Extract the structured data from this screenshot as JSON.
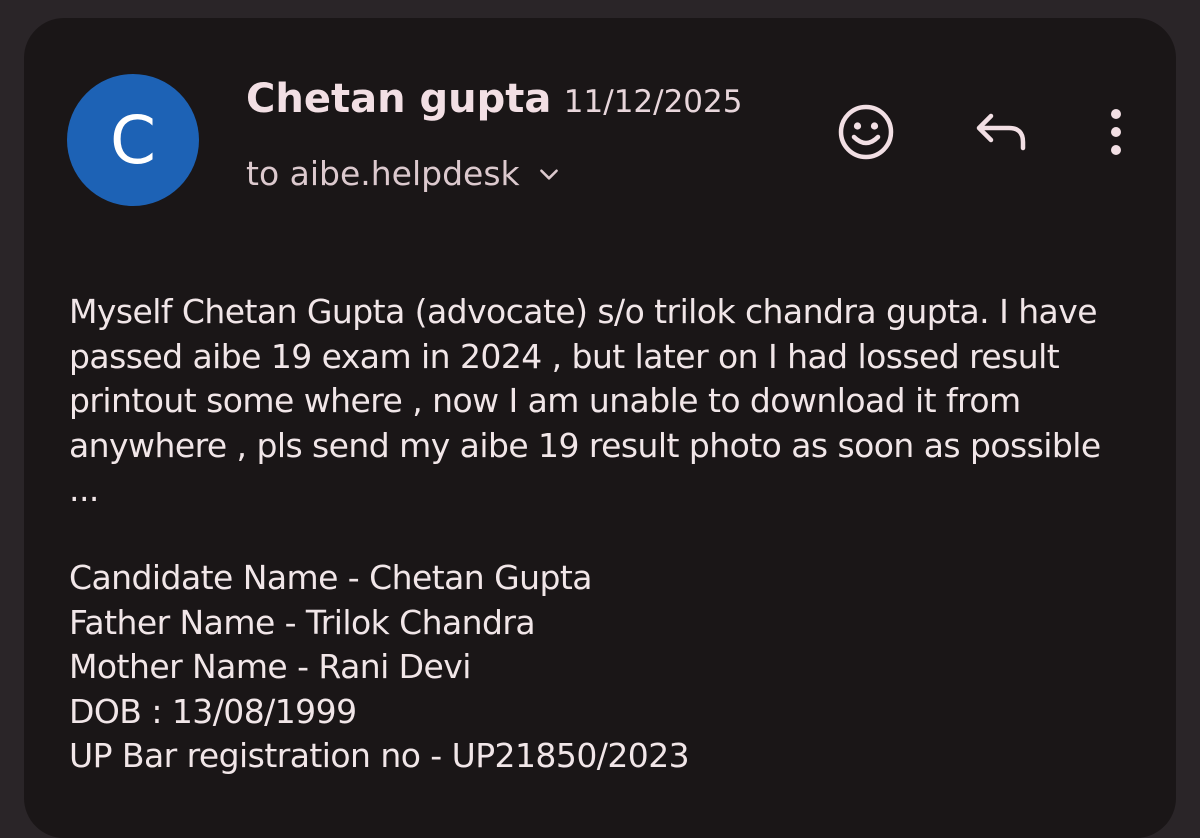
{
  "email": {
    "sender": {
      "avatar_letter": "C",
      "name": "Chetan gupta",
      "date": "11/12/2025"
    },
    "recipient": "to aibe.helpdesk",
    "actions": {
      "emoji_icon": "smiley-icon",
      "reply_icon": "reply-icon",
      "more_icon": "more-vertical-icon"
    },
    "body": "Myself Chetan Gupta (advocate) s/o trilok chandra gupta. I have passed aibe 19 exam in 2024 , but later on I had lossed result printout some where , now I am unable to download it from anywhere , pls send my aibe 19 result photo as soon as possible ...",
    "details": [
      "Candidate Name - Chetan Gupta",
      "Father Name - Trilok Chandra",
      "Mother Name - Rani Devi",
      "DOB : 13/08/1999",
      "UP Bar registration no - UP21850/2023"
    ]
  },
  "colors": {
    "background": "#2a2528",
    "card": "#1a1617",
    "avatar": "#1d62b5",
    "text": "#f1e6e8"
  }
}
